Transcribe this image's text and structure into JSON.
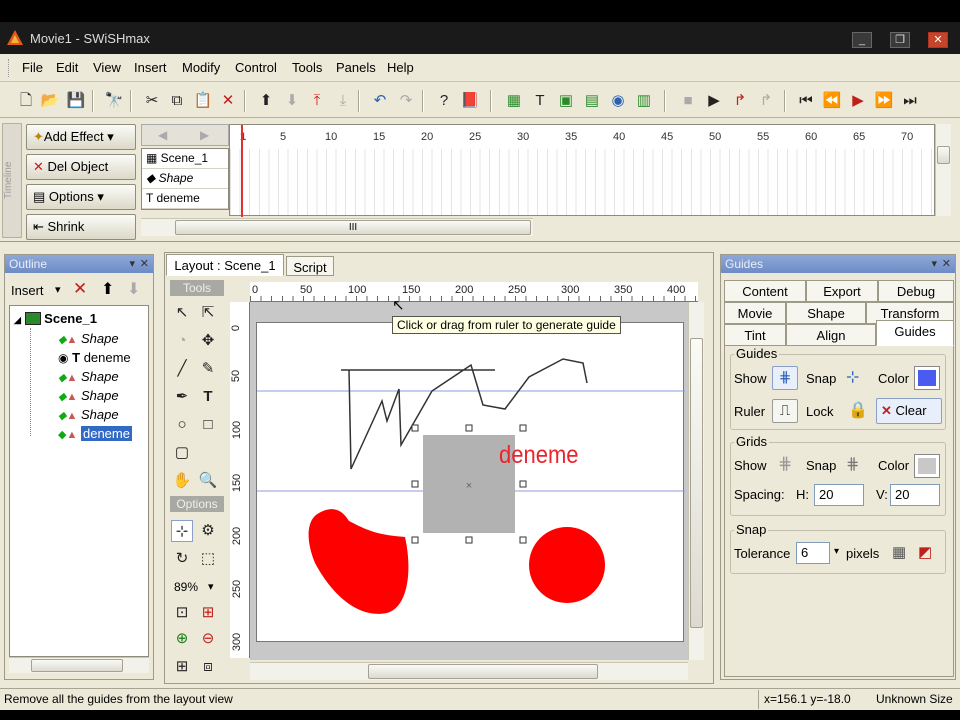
{
  "window": {
    "title": "Movie1 - SWiSHmax"
  },
  "menu": [
    "File",
    "Edit",
    "View",
    "Insert",
    "Modify",
    "Control",
    "Tools",
    "Panels",
    "Help"
  ],
  "timeline": {
    "side_label": "Timeline",
    "buttons": {
      "add_effect": "Add Effect",
      "del_object": "Del Object",
      "options": "Options",
      "shrink": "Shrink"
    },
    "layers": [
      "Scene_1",
      "Shape",
      "deneme"
    ],
    "frame_numbers": [
      "1",
      "5",
      "10",
      "15",
      "20",
      "25",
      "30",
      "35",
      "40",
      "45",
      "50",
      "55",
      "60",
      "65",
      "70"
    ],
    "scroll_label": "III"
  },
  "outline": {
    "title": "Outline",
    "insert_label": "Insert",
    "scene": "Scene_1",
    "items": [
      "Shape",
      "deneme",
      "Shape",
      "Shape",
      "Shape",
      "deneme"
    ]
  },
  "layout": {
    "tabs": [
      "Layout : Scene_1",
      "Script"
    ],
    "tools_header": "Tools",
    "options_header": "Options",
    "zoom": "89%",
    "ruler_h": [
      "0",
      "50",
      "100",
      "150",
      "200",
      "250",
      "300",
      "350",
      "400"
    ],
    "ruler_v": [
      "0",
      "50",
      "100",
      "150",
      "200",
      "250",
      "300"
    ],
    "tooltip": "Click or drag from ruler to generate guide",
    "text_object": "deneme"
  },
  "guides_panel": {
    "title": "Guides",
    "tabs_row1": [
      "Content",
      "Export",
      "Debug"
    ],
    "tabs_row2": [
      "Movie",
      "Shape",
      "Transform"
    ],
    "tabs_row3": [
      "Tint",
      "Align",
      "Guides"
    ],
    "guides_group": "Guides",
    "show": "Show",
    "snap": "Snap",
    "color": "Color",
    "ruler": "Ruler",
    "lock": "Lock",
    "clear": "Clear",
    "grids_group": "Grids",
    "spacing": "Spacing:",
    "h_label": "H:",
    "h_value": "20",
    "v_label": "V:",
    "v_value": "20",
    "snap_group": "Snap",
    "tolerance": "Tolerance",
    "tolerance_value": "6",
    "pixels": "pixels",
    "guide_color": "#4a5cf0"
  },
  "status": {
    "message": "Remove all the guides from the layout view",
    "coords": "x=156.1 y=-18.0",
    "size": "Unknown Size"
  },
  "colors": {
    "shape_red": "#ff0000",
    "selection_gray": "#b2b2b2",
    "text_red": "#e8262c"
  }
}
